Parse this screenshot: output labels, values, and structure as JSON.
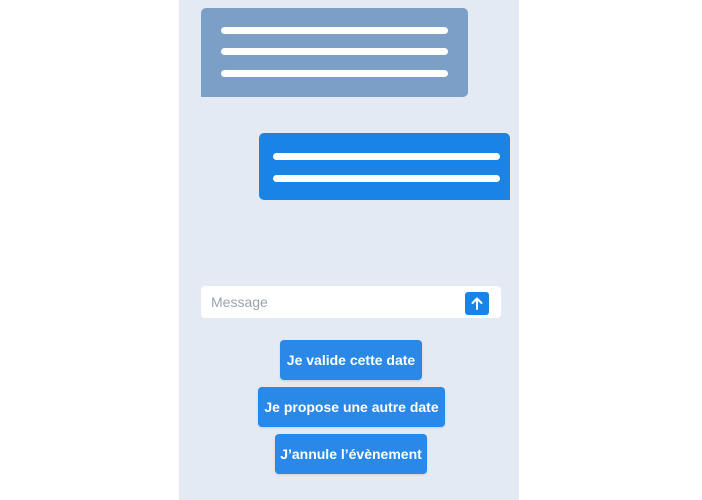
{
  "composer": {
    "placeholder": "Message",
    "send_icon": "arrow-up-icon"
  },
  "actions": {
    "validate_label": "Je valide cette date",
    "propose_label": "Je propose une autre date",
    "cancel_label": "J’annule l’évènement"
  },
  "colors": {
    "panel_background": "#e3eaf4",
    "received_bubble": "#7c9fc7",
    "sent_bubble": "#1a84e6",
    "accent": "#2a88e8"
  }
}
